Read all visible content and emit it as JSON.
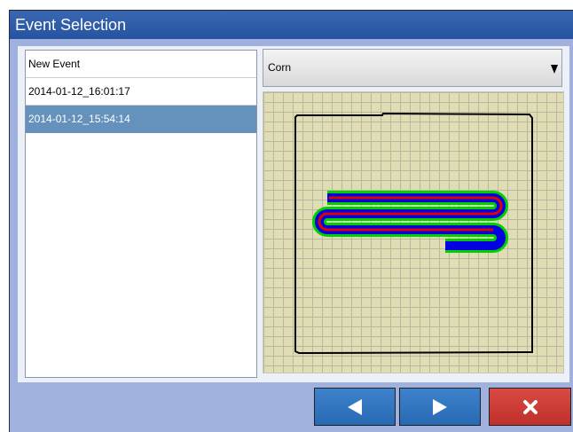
{
  "window": {
    "title": "Event Selection"
  },
  "events": {
    "items": [
      {
        "label": "New Event",
        "selected": false
      },
      {
        "label": "2014-01-12_16:01:17",
        "selected": false
      },
      {
        "label": "2014-01-12_15:54:14",
        "selected": true
      }
    ]
  },
  "crop": {
    "selected": "Corn"
  },
  "map": {
    "field_boundary_color": "#000000",
    "pass_colors": {
      "outer": "#00d000",
      "middle": "#0000e0",
      "inner": "#e00000"
    }
  },
  "buttons": {
    "previous": {
      "icon": "triangle-left-icon"
    },
    "next": {
      "icon": "triangle-right-icon"
    },
    "close": {
      "icon": "x-icon",
      "color": "#c8342e"
    }
  }
}
